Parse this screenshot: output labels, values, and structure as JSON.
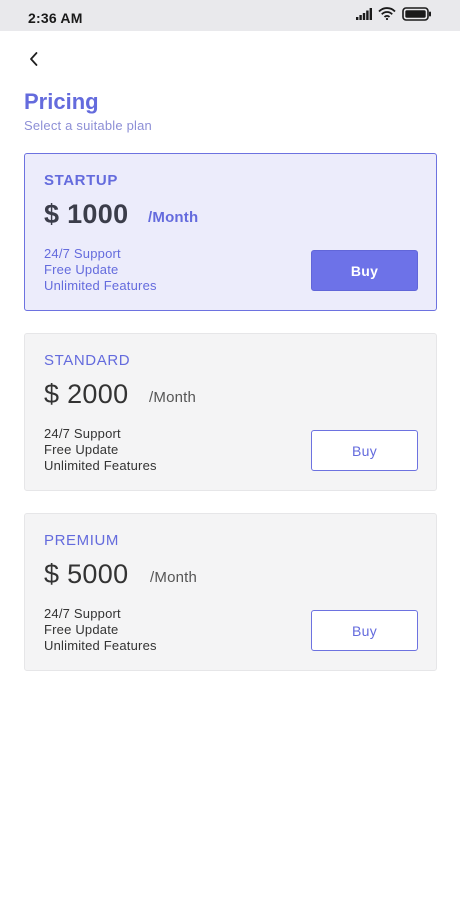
{
  "status_bar": {
    "time": "2:36 AM"
  },
  "header": {
    "title": "Pricing",
    "subtitle": "Select a suitable plan"
  },
  "plans": [
    {
      "name": "STARTUP",
      "price": "$ 1000",
      "period": "/Month",
      "features": [
        "24/7 Support",
        "Free Update",
        "Unlimited Features"
      ],
      "button_label": "Buy",
      "featured": true
    },
    {
      "name": "STANDARD",
      "price": "$ 2000",
      "period": "/Month",
      "features": [
        "24/7 Support",
        "Free Update",
        "Unlimited Features"
      ],
      "button_label": "Buy",
      "featured": false
    },
    {
      "name": "PREMIUM",
      "price": "$ 5000",
      "period": "/Month",
      "features": [
        "24/7 Support",
        "Free Update",
        "Unlimited Features"
      ],
      "button_label": "Buy",
      "featured": false
    }
  ],
  "colors": {
    "accent": "#646bdd",
    "featured_bg": "#ececfb",
    "card_bg": "#f4f4f5",
    "status_bar_bg": "#e9e9ec"
  },
  "icons": {
    "back": "chevron-left-icon",
    "signal": "signal-icon",
    "wifi": "wifi-icon",
    "battery": "battery-icon"
  }
}
